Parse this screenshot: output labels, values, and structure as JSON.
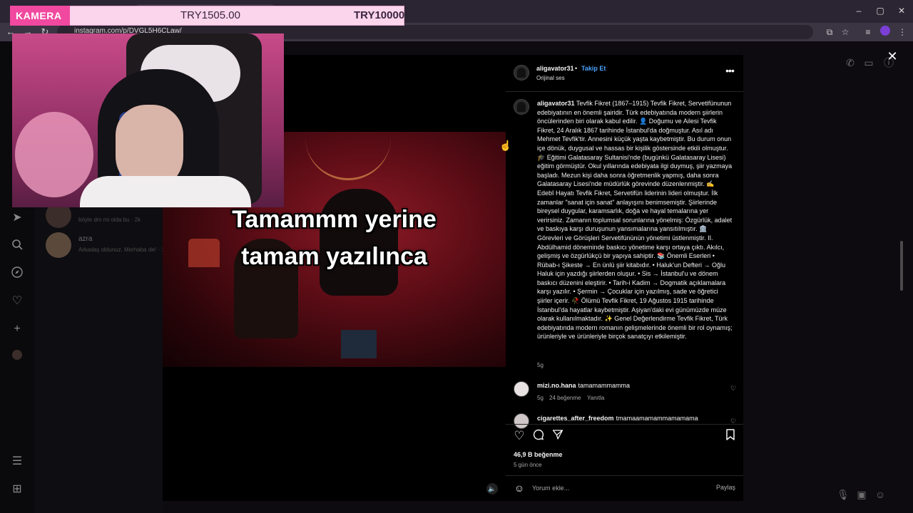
{
  "browser": {
    "url": "instagram.com/p/DVGL5H6CLaw/",
    "window_min": "–",
    "window_max": "▢",
    "window_close": "✕"
  },
  "overlay": {
    "label": "KAMERA",
    "current_amount": "TRY1505.00",
    "goal_amount": "TRY10000"
  },
  "dm_list": [
    {
      "name": "",
      "preview": "böyle dm mi olda bu · 2k"
    },
    {
      "name": "azra",
      "preview": "Arkadaş oldunuz. Merhaba de! · 1"
    }
  ],
  "video": {
    "caption_line1": "Tamammm yerine",
    "caption_line2": "tamam yazılınca"
  },
  "post": {
    "username": "aligavator31",
    "dot": "•",
    "follow_label": "Takip Et",
    "audio_label": "Orijinal ses",
    "more_label": "•••",
    "caption_user": "aligavator31",
    "caption_text": "Tevfik Fikret (1867–1915) Tevfik Fikret, Servetifünunun edebiyatının en önemli şairidir. Türk edebiyatında modern şiirlerin öncülerinden biri olarak kabul edilir. 👤 Doğumu ve Ailesi Tevfik Fikret, 24 Aralık 1867 tarihinde İstanbul'da doğmuştur. Asıl adı Mehmet Tevfik'tir. Annesini küçük yaşta kaybetmiştir. Bu durum onun içe dönük, duygusal ve hassas bir kişilik göstersinde etkili olmuştur. 🎓 Eğitimi Galatasaray Sultanisi'nde (bugünkü Galatasaray Lisesi) eğitim görmüştür. Okul yıllarında edebiyata ilgi duymuş, şiir yazmaya başladı. Mezun kişi daha sonra öğretmenlik yapmış, daha sonra Galatasaray Lisesi'nde müdürlük görevinde düzenlenmiştir. ✍️ Edebî Hayatı Tevfik Fikret, Servetifün liderinin lideri olmuştur. İlk zamanlar \"sanat için sanat\" anlayışını benimsemiştir. Şiirlerinde bireysel duygular, karamsarlık, doğa ve hayal temalarına yer verirsiniz. Zamanın toplumsal sorunlarına yönelmiş: Özgürlük, adalet ve baskıya karşı duruşunun yansımalarına yansıtılmıştır. 🏛️ Görevleri ve Görüşleri Servetifününün yönetimi üstlenmiştir. II. Abdülhamid döneminde baskıcı yönetime karşı ortaya çıktı. Akılcı, gelişmiş ve özgürlükçü bir yapıya sahiptir. 📚 Önemli Eserleri • Rübab-ı Şikeste → En ünlü şiir kitabıdır. • Haluk'un Defteri → Oğlu Haluk için yazdığı şiirlerden oluşur. • Sis → İstanbul'u ve dönem baskıcı düzenini eleştirir. • Tarih-i Kadim → Dogmatik açıklamalara karşı yazılır. • Şermin → Çocuklar için yazılmış, sade ve öğretici şiirler içerir. 🥀 Ölümü Tevfik Fikret, 19 Ağustos 1915 tarihinde İstanbul'da hayatlar kaybetmiştir. Aşiyan'daki evi günümüzde müze olarak kullanılmaktadır. ✨ Genel Değerlendirme Tevfik Fikret, Türk edebiyatında modern romanın gelişmelerinde önemli bir rol oynamış; ürünleriyle ve ürünleriyle birçok sanatçıyı etkilemiştir.",
    "post_age": "5g",
    "comments": [
      {
        "user": "mizi.no.hana",
        "text": "tamamammamma",
        "age": "5g",
        "likes": "24 beğenme",
        "reply": "Yanıtla"
      },
      {
        "user": "cigarettes_after_freedom",
        "text": "tmamaamamammamamama"
      }
    ],
    "likes_count": "46,9 B beğenme",
    "time_ago": "5 gün önce",
    "comment_placeholder": "Yorum ekle...",
    "share_label": "Paylaş"
  }
}
